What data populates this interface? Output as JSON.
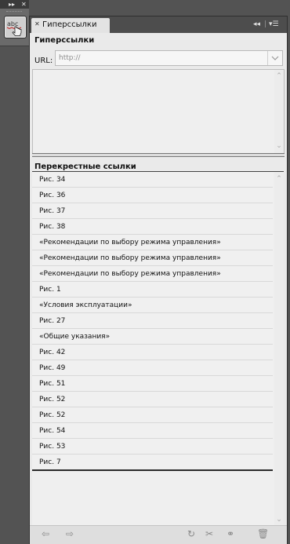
{
  "dock": {
    "expand_icon": "double-chevron-right-icon",
    "close_icon": "close-icon",
    "tool_icon": "spellcheck-abc-hand-icon",
    "tool_text": "abc"
  },
  "panel": {
    "tab": {
      "title": "Гиперссылки"
    },
    "controls": {
      "collapse_icon": "double-chevron-left-icon",
      "menu_icon": "panel-menu-icon"
    }
  },
  "hyperlinks": {
    "title": "Гиперссылки",
    "url_label": "URL:",
    "url_placeholder": "http://"
  },
  "cross_references": {
    "title": "Перекрестные ссылки",
    "items": [
      "Рис. 34",
      "Рис. 36",
      "Рис. 37",
      "Рис. 38",
      "«Рекомендации по выбору режима управления»",
      "«Рекомендации по выбору режима управления»",
      "«Рекомендации по выбору режима управления»",
      "Рис. 1",
      "«Условия эксплуатации»",
      "Рис. 27",
      "«Общие указания»",
      "Рис. 42",
      "Рис. 49",
      "Рис. 51",
      "Рис. 52",
      "Рис. 52",
      "Рис. 54",
      "Рис. 53",
      "Рис. 7"
    ]
  },
  "footer": {
    "icons": [
      "go-to-source-icon",
      "go-to-destination-icon",
      "update-icon",
      "create-cross-reference-icon",
      "create-hyperlink-icon",
      "delete-icon"
    ]
  }
}
